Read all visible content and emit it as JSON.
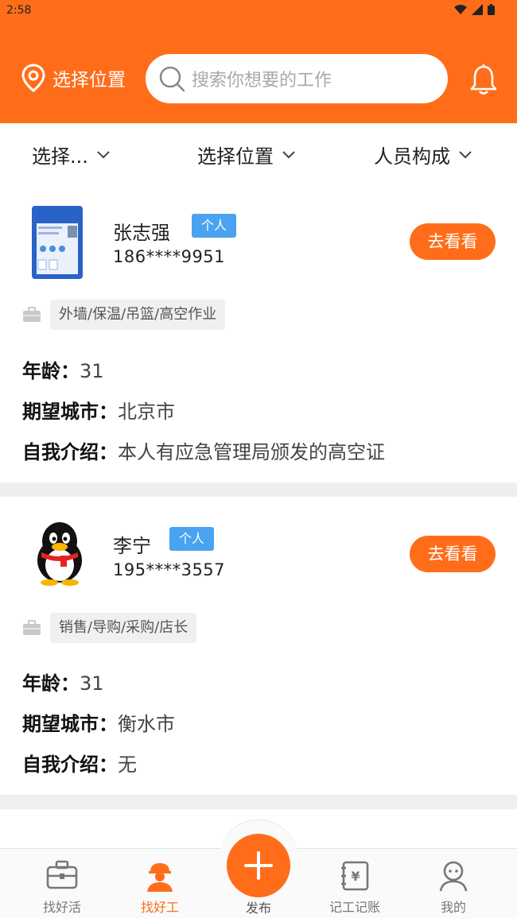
{
  "status_bar": {
    "time": "2:58"
  },
  "header": {
    "location_label": "选择位置",
    "search_placeholder": "搜索你想要的工作"
  },
  "filters": [
    {
      "label": "选择..."
    },
    {
      "label": "选择位置"
    },
    {
      "label": "人员构成"
    }
  ],
  "workers": [
    {
      "name": "张志强",
      "type_tag": "个人",
      "phone": "186****9951",
      "action_label": "去看看",
      "skills": "外墙/保温/吊篮/高空作业",
      "age_label": "年龄：",
      "age": "31",
      "city_label": "期望城市：",
      "city": "北京市",
      "intro_label": "自我介绍：",
      "intro": "本人有应急管理局颁发的高空证"
    },
    {
      "name": "李宁",
      "type_tag": "个人",
      "phone": "195****3557",
      "action_label": "去看看",
      "skills": "销售/导购/采购/店长",
      "age_label": "年龄：",
      "age": "31",
      "city_label": "期望城市：",
      "city": "衡水市",
      "intro_label": "自我介绍：",
      "intro": "无"
    }
  ],
  "tabbar": {
    "items": [
      {
        "label": "找好活",
        "icon": "briefcase-icon"
      },
      {
        "label": "找好工",
        "icon": "worker-icon",
        "active": true
      },
      {
        "label": "发布",
        "icon": "plus-icon"
      },
      {
        "label": "记工记账",
        "icon": "ledger-icon"
      },
      {
        "label": "我的",
        "icon": "profile-icon"
      }
    ]
  },
  "colors": {
    "accent": "#ff6d1a",
    "tag_blue": "#4aa3f0"
  }
}
